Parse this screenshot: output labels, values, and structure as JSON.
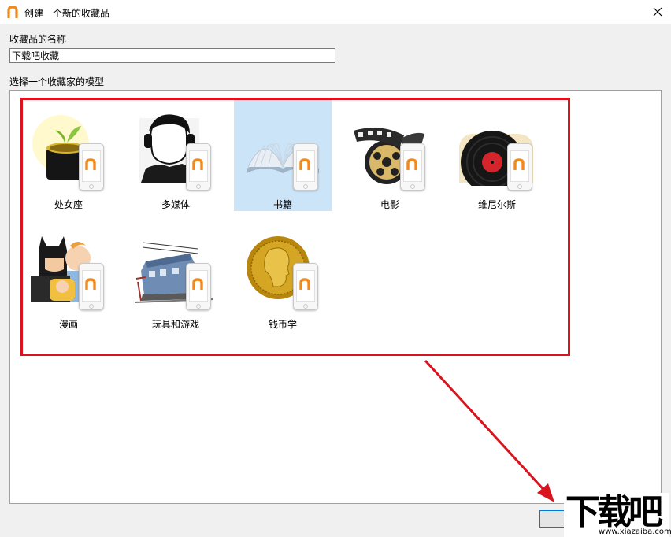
{
  "window": {
    "title": "创建一个新的收藏品"
  },
  "name_field": {
    "label": "收藏品的名称",
    "value": "下载吧收藏"
  },
  "model_section": {
    "label": "选择一个收藏家的模型"
  },
  "models": [
    {
      "label": "处女座",
      "icon": "plant-icon",
      "selected": false
    },
    {
      "label": "多媒体",
      "icon": "person-headphones-icon",
      "selected": false
    },
    {
      "label": "书籍",
      "icon": "book-icon",
      "selected": true
    },
    {
      "label": "电影",
      "icon": "film-reel-icon",
      "selected": false
    },
    {
      "label": "维尼尔斯",
      "icon": "vinyl-record-icon",
      "selected": false
    },
    {
      "label": "漫画",
      "icon": "comics-icon",
      "selected": false
    },
    {
      "label": "玩具和游戏",
      "icon": "toy-train-icon",
      "selected": false
    },
    {
      "label": "钱币学",
      "icon": "gold-coin-icon",
      "selected": false
    }
  ],
  "watermark": {
    "text": "下载吧",
    "url": "www.xiazaiba.com"
  },
  "colors": {
    "selection": "#cce4f7",
    "highlight_border": "#d9141f",
    "brand_orange": "#f08a1c"
  }
}
